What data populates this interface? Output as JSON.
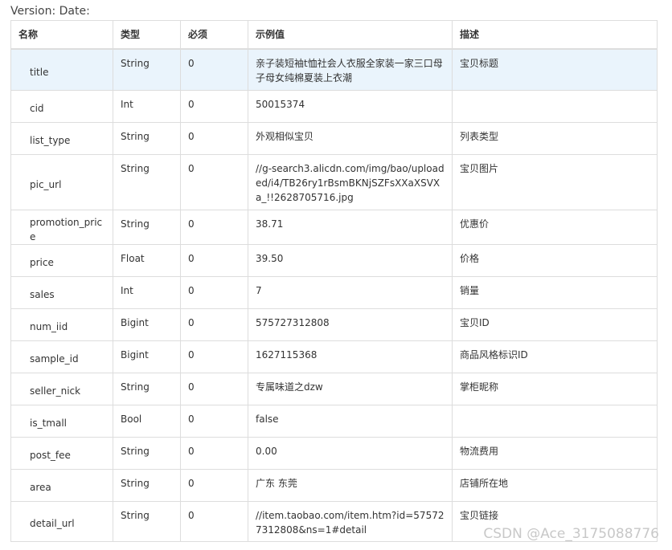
{
  "version_line": "Version: Date:",
  "headers": {
    "name": "名称",
    "type": "类型",
    "required": "必须",
    "example": "示例值",
    "desc": "描述"
  },
  "rows": [
    {
      "name": "title",
      "type": "String",
      "required": "0",
      "example": "亲子装短袖t恤社会人衣服全家装一家三口母子母女纯棉夏装上衣潮",
      "desc": "宝贝标题"
    },
    {
      "name": "cid",
      "type": "Int",
      "required": "0",
      "example": "50015374",
      "desc": ""
    },
    {
      "name": "list_type",
      "type": "String",
      "required": "0",
      "example": "外观相似宝贝",
      "desc": "列表类型"
    },
    {
      "name": "pic_url",
      "type": "String",
      "required": "0",
      "example": "//g-search3.alicdn.com/img/bao/uploaded/i4/TB26ry1rBsmBKNjSZFsXXaXSVXa_!!2628705716.jpg",
      "desc": "宝贝图片"
    },
    {
      "name": "promotion_price",
      "type": "String",
      "required": "0",
      "example": "38.71",
      "desc": "优惠价"
    },
    {
      "name": "price",
      "type": "Float",
      "required": "0",
      "example": "39.50",
      "desc": "价格"
    },
    {
      "name": "sales",
      "type": "Int",
      "required": "0",
      "example": "7",
      "desc": "销量"
    },
    {
      "name": "num_iid",
      "type": "Bigint",
      "required": "0",
      "example": "575727312808",
      "desc": "宝贝ID"
    },
    {
      "name": "sample_id",
      "type": "Bigint",
      "required": "0",
      "example": "1627115368",
      "desc": "商品风格标识ID"
    },
    {
      "name": "seller_nick",
      "type": "String",
      "required": "0",
      "example": "专属味道之dzw",
      "desc": "掌柜昵称"
    },
    {
      "name": "is_tmall",
      "type": "Bool",
      "required": "0",
      "example": "false",
      "desc": ""
    },
    {
      "name": "post_fee",
      "type": "String",
      "required": "0",
      "example": "0.00",
      "desc": "物流费用"
    },
    {
      "name": "area",
      "type": "String",
      "required": "0",
      "example": "广东 东莞",
      "desc": "店铺所在地"
    },
    {
      "name": "detail_url",
      "type": "String",
      "required": "0",
      "example": "//item.taobao.com/item.htm?id=575727312808&ns=1#detail",
      "desc": "宝贝链接"
    }
  ],
  "watermark": "CSDN @Ace_3175088776",
  "colors": {
    "highlight_row": "#eaf4fc",
    "border": "#dddddd",
    "watermark": "#c8c8c8"
  }
}
